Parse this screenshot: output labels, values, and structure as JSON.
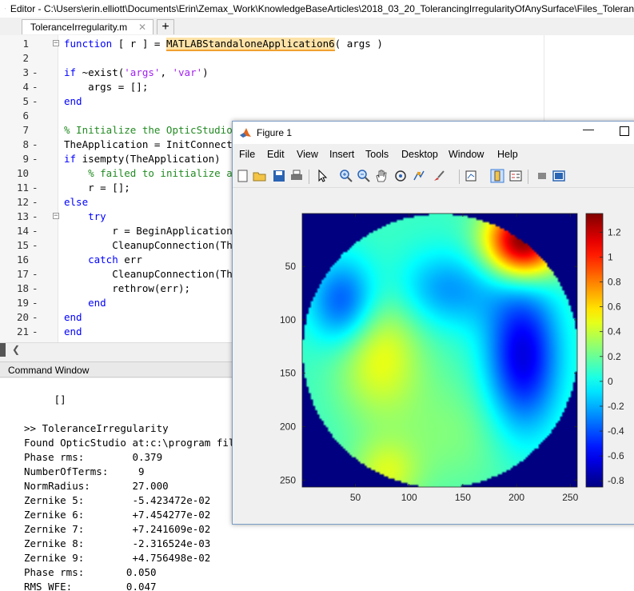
{
  "editor": {
    "title": "Editor - C:\\Users\\erin.elliott\\Documents\\Erin\\Zemax_Work\\KnowledgeBaseArticles\\2018_03_20_TolerancingIrregularityOfAnySurface\\Files_Toleran",
    "tab_label": "ToleranceIrregularity.m",
    "tab_close": "✕",
    "tab_add": "+",
    "lines": [
      {
        "n": "1",
        "dash": "",
        "fold": "⊟",
        "html": "<span class=\"kw\">function</span> [ r ] = <span class=\"warn\">MATLABStandaloneApplication6</span>( args )"
      },
      {
        "n": "2",
        "dash": "",
        "fold": "",
        "html": ""
      },
      {
        "n": "3",
        "dash": "-",
        "fold": "",
        "html": "<span class=\"kw\">if</span> ~exist(<span class=\"str\">'args'</span>, <span class=\"str\">'var'</span>)"
      },
      {
        "n": "4",
        "dash": "-",
        "fold": "",
        "html": "    args = [];"
      },
      {
        "n": "5",
        "dash": "-",
        "fold": "",
        "html": "<span class=\"kw\">end</span>"
      },
      {
        "n": "6",
        "dash": "",
        "fold": "",
        "html": ""
      },
      {
        "n": "7",
        "dash": "",
        "fold": "",
        "html": "<span class=\"cm\">% Initialize the OpticStudio connection</span>"
      },
      {
        "n": "8",
        "dash": "-",
        "fold": "",
        "html": "TheApplication = InitConnection();"
      },
      {
        "n": "9",
        "dash": "-",
        "fold": "",
        "html": "<span class=\"kw\">if</span> isempty(TheApplication)"
      },
      {
        "n": "10",
        "dash": "",
        "fold": "",
        "html": "    <span class=\"cm\">% failed to initialize a connection</span>"
      },
      {
        "n": "11",
        "dash": "-",
        "fold": "",
        "html": "    r = [];"
      },
      {
        "n": "12",
        "dash": "-",
        "fold": "",
        "html": "<span class=\"kw\">else</span>"
      },
      {
        "n": "13",
        "dash": "-",
        "fold": "⊟",
        "html": "    <span class=\"kw\">try</span>"
      },
      {
        "n": "14",
        "dash": "-",
        "fold": "",
        "html": "        r = BeginApplication(TheApplication, args);"
      },
      {
        "n": "15",
        "dash": "-",
        "fold": "",
        "html": "        CleanupConnection(TheApplication);"
      },
      {
        "n": "16",
        "dash": "",
        "fold": "",
        "html": "    <span class=\"kw\">catch</span> err"
      },
      {
        "n": "17",
        "dash": "-",
        "fold": "",
        "html": "        CleanupConnection(TheApplication);"
      },
      {
        "n": "18",
        "dash": "-",
        "fold": "",
        "html": "        rethrow(err);"
      },
      {
        "n": "19",
        "dash": "-",
        "fold": "",
        "html": "    <span class=\"kw\">end</span>"
      },
      {
        "n": "20",
        "dash": "-",
        "fold": "",
        "html": "<span class=\"kw\">end</span>"
      },
      {
        "n": "21",
        "dash": "-",
        "fold": "",
        "html": "<span class=\"kw\">end</span>"
      }
    ]
  },
  "command_window": {
    "header": "Command Window",
    "lines": [
      "",
      "     []",
      "",
      ">> ToleranceIrregularity",
      "Found OpticStudio at:c:\\program files\\zemax opticstudio",
      "Phase rms:        0.379",
      "NumberOfTerms:     9",
      "NormRadius:       27.000",
      "Zernike 5:        -5.423472e-02",
      "Zernike 6:        +7.454277e-02",
      "Zernike 7:        +7.241609e-02",
      "Zernike 8:        -2.316524e-03",
      "Zernike 9:        +4.756498e-02",
      "Phase rms:       0.050",
      "RMS WFE:         0.047"
    ]
  },
  "figure": {
    "title": "Figure 1",
    "min_glyph": "—",
    "menus": [
      "File",
      "Edit",
      "View",
      "Insert",
      "Tools",
      "Desktop",
      "Window",
      "Help"
    ],
    "toolbar_icons": [
      "new-figure-icon",
      "open-file-icon",
      "save-icon",
      "print-icon",
      "pointer-icon",
      "zoom-in-icon",
      "zoom-out-icon",
      "pan-icon",
      "rotate-icon",
      "data-cursor-icon",
      "brush-icon",
      "link-plot-icon",
      "colorbar-icon",
      "legend-icon",
      "hide-tools-icon",
      "show-tools-icon"
    ]
  },
  "chart_data": {
    "type": "heatmap",
    "title": "",
    "xlabel": "",
    "ylabel": "",
    "xlim": [
      0.5,
      256.5
    ],
    "ylim": [
      256.5,
      0.5
    ],
    "x_ticks": [
      50,
      100,
      150,
      200,
      250
    ],
    "y_ticks": [
      50,
      100,
      150,
      200,
      250
    ],
    "colorbar": {
      "ticks": [
        1.2,
        1,
        0.8,
        0.6,
        0.4,
        0.2,
        0,
        -0.2,
        -0.4,
        -0.6,
        -0.8
      ],
      "tick_labels": [
        "1.2",
        "1",
        "0.8",
        "0.6",
        "0.4",
        "0.2",
        "0",
        "-0.2",
        "-0.4",
        "-0.6",
        "-0.8"
      ],
      "range": [
        -0.85,
        1.35
      ],
      "colormap": "jet"
    },
    "pupil": {
      "center": [
        128.5,
        128.5
      ],
      "radius": 128
    },
    "background_value": -0.85
  }
}
